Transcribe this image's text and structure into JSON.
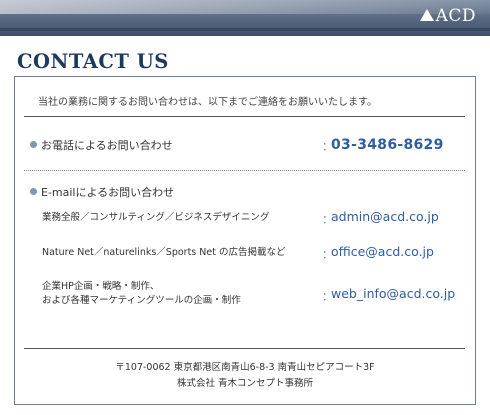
{
  "header": {
    "logo_text": "ACD"
  },
  "page": {
    "title": "CONTACT US",
    "intro": "当社の業務に関するお問い合わせは、以下までご連絡をお願いいたします。"
  },
  "phone_section": {
    "heading": "お電話によるお問い合わせ",
    "separator": "：",
    "number": "03-3486-8629"
  },
  "email_section": {
    "heading": "E-mailによるお問い合わせ",
    "separator": "：",
    "items": [
      {
        "label_line1": "業務全般／コンサルティング／ビジネスデザイニング",
        "label_line2": "",
        "email": "admin@acd.co.jp"
      },
      {
        "label_line1": "Nature Net／naturelinks／Sports Net の広告掲載など",
        "label_line2": "",
        "email": "office@acd.co.jp"
      },
      {
        "label_line1": "企業HP企画・戦略・制作、",
        "label_line2": "および各種マーケティングツールの企画・制作",
        "email": "web_info@acd.co.jp"
      }
    ]
  },
  "footer": {
    "address": "〒107-0062 東京都港区南青山6-8-3 南青山セピアコート3F",
    "company": "株式会社 青木コンセプト事務所"
  },
  "colors": {
    "header_bar": "#5d6c84",
    "title": "#1d3a5e",
    "link": "#2f5da0",
    "bullet": "#8296b4"
  }
}
